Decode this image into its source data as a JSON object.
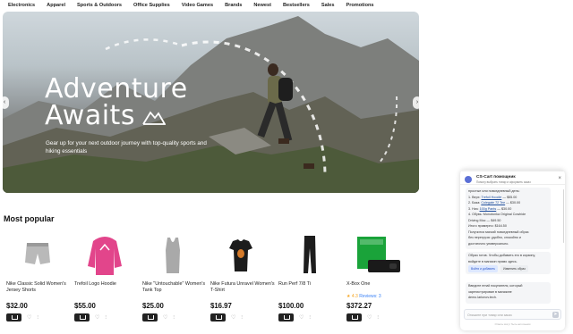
{
  "nav": [
    "Electronics",
    "Apparel",
    "Sports & Outdoors",
    "Office Supplies",
    "Video Games",
    "Brands",
    "Newest",
    "Bestsellers",
    "Sales",
    "Promotions"
  ],
  "hero": {
    "title_line1": "Adventure",
    "title_line2": "Awaits",
    "subtitle": "Gear up for your next outdoor journey with top-quality sports and hiking essentials",
    "arrow_left": "‹",
    "arrow_right": "›"
  },
  "popular": {
    "title": "Most popular",
    "products": [
      {
        "name": "Nike Classic Solid Women's Jersey Shorts",
        "price": "$32.00",
        "rating_stars": "",
        "rating_text": ""
      },
      {
        "name": "Trefoil Logo Hoodie",
        "price": "$55.00",
        "rating_stars": "",
        "rating_text": ""
      },
      {
        "name": "Nike \"Untouchable\" Women's Tank Top",
        "price": "$25.00",
        "rating_stars": "",
        "rating_text": ""
      },
      {
        "name": "Nike Futura Unravel Women's T-Shirt",
        "price": "$16.97",
        "rating_stars": "",
        "rating_text": ""
      },
      {
        "name": "Run Perf 7/8 Ti",
        "price": "$100.00",
        "rating_stars": "",
        "rating_text": ""
      },
      {
        "name": "X-Box One",
        "price": "$372.27",
        "rating_stars": "★ 4.3",
        "rating_text": "Reviews: 3"
      }
    ]
  },
  "chat": {
    "title": "CS-Cart помощник",
    "subtitle": "Помогу выбрать товар и оформить заказ",
    "close": "×",
    "messages": {
      "m1_lines": [
        "простые или повседневный день:",
        "",
        "1. Верх: Trefoil Hoodie — $55.00",
        "2. База: Colegate 72 Tee — $30.00",
        "3. Низ: 100g Pants — $30.00",
        "4. Обувь: Monotonka Original Cowhide",
        "Driving Moc — $49.50",
        "",
        "Итого примерно: $164.50",
        "Получится мягкий повседневный образ",
        "без перегруза: удобно, спокойно и",
        "достаточно универсально."
      ],
      "m2_lines": [
        "Образ готов. Чтобы добавить его в корзину,",
        "войдите в магазин прямо здесь."
      ],
      "btn_login": "Войти и добавить",
      "btn_change": "Изменить образ",
      "m3_lines": [
        "Введите email покупателя, который",
        "зарегистрирован в магазине",
        "demo.larionov.tech."
      ]
    },
    "input_placeholder": "Опишите при товар или заказ",
    "send": "➤",
    "footer": "Ответы могут быть неточными"
  }
}
